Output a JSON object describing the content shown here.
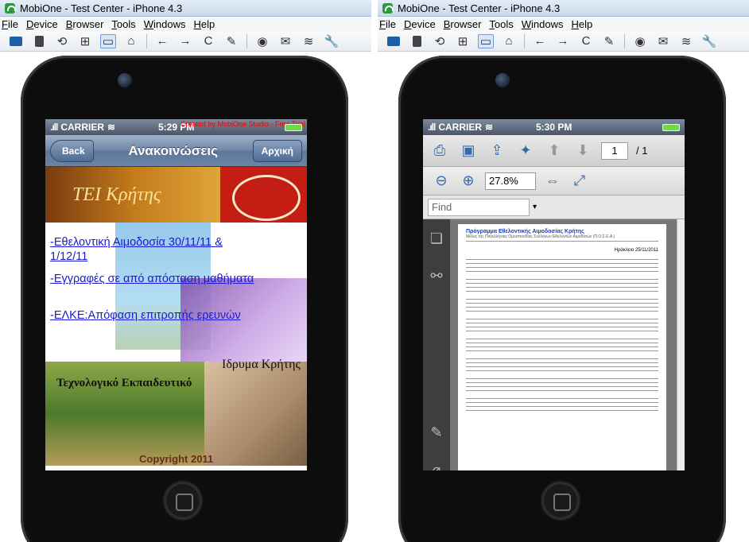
{
  "windows": [
    {
      "title": "MobiOne - Test Center - iPhone 4.3",
      "menu": [
        "File",
        "Device",
        "Browser",
        "Tools",
        "Windows",
        "Help"
      ],
      "status": {
        "carrier": "CARRIER",
        "time": "5:29 PM",
        "watermark": "Created by MobiOne Studio - Free Trial"
      },
      "nav": {
        "back": "Back",
        "title": "Ανακοινώσεις",
        "home": "Αρχική"
      },
      "banner_text": "ΤΕΙ Κρήτης",
      "links": [
        "-Εθελοντική Αιμοδοσία 30/11/11 & 1/12/11",
        "-Εγγραφές σε από απόσταση μαθήματα",
        "-ΕΛΚΕ:Απόφαση επιτροπής ερευνών"
      ],
      "image_text_1": "Ιδρυμα Κρήτης",
      "image_text_2": "Τεχνολογικό Εκπαιδευτικό",
      "copyright": "Copyright 2011"
    },
    {
      "title": "MobiOne - Test Center - iPhone 4.3",
      "menu": [
        "File",
        "Device",
        "Browser",
        "Tools",
        "Windows",
        "Help"
      ],
      "status": {
        "carrier": "CARRIER",
        "time": "5:30 PM"
      },
      "pdf": {
        "page_current": "1",
        "page_total": "/ 1",
        "zoom": "27.8%",
        "find_placeholder": "Find",
        "header_title": "Πρόγραμμα Εθελοντικής Αιμοδοσίας Κρήτης",
        "header_sub": "Μέλος της Πανελλήνιας Ομοσπονδίας Συλλόγων Εθελοντών Αιμοδοτών (Π.Ο.Σ.Ε.Α.)",
        "date": "Ηράκλειο 25/11/2011"
      }
    }
  ]
}
